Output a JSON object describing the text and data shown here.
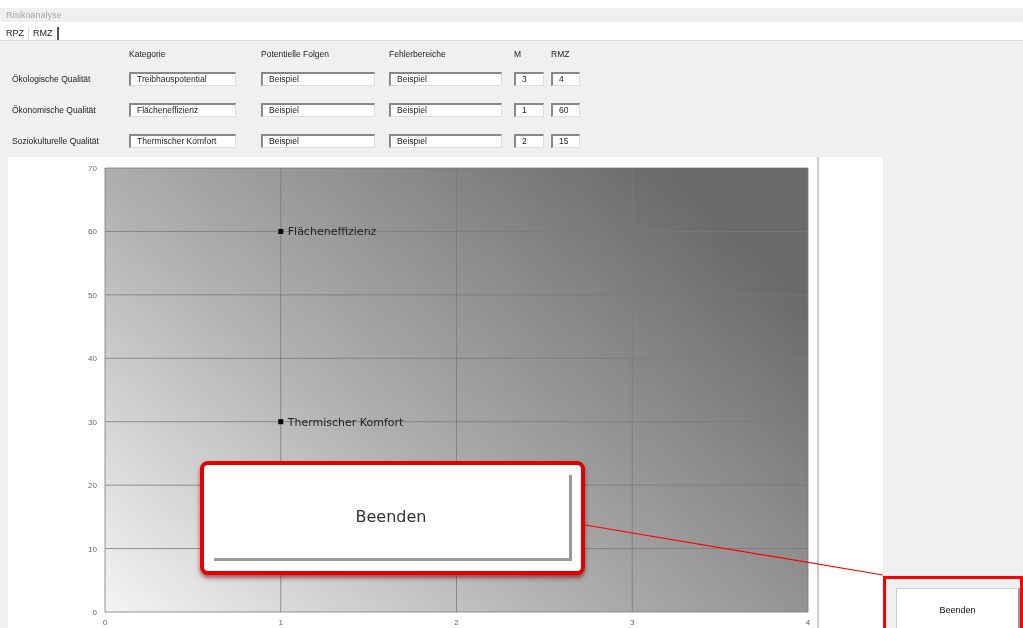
{
  "window": {
    "title": "Risikoanalyse"
  },
  "tabs": [
    {
      "label": "RPZ",
      "selected": false
    },
    {
      "label": "RMZ",
      "selected": true
    }
  ],
  "form": {
    "columns": [
      "Kategorie",
      "Potentielle Folgen",
      "Fehlerbereiche",
      "M",
      "RMZ"
    ],
    "rows": [
      {
        "label": "Ökologische Qualität",
        "values": [
          "Treibhauspotential",
          "Beispiel",
          "Beispiel",
          "3",
          "4"
        ]
      },
      {
        "label": "Ökonomische Qualität",
        "values": [
          "Flächeneffizienz",
          "Beispiel",
          "Beispiel",
          "1",
          "60"
        ]
      },
      {
        "label": "Soziokulturelle Qualität",
        "values": [
          "Thermischer Komfort",
          "Beispiel",
          "Beispiel",
          "2",
          "15"
        ]
      }
    ]
  },
  "chart": {
    "chart_data": {
      "type": "scatter",
      "x": [
        1,
        1
      ],
      "series": [
        {
          "color": "#000000",
          "values": [
            60,
            30
          ]
        }
      ],
      "grid": true,
      "xlim": [
        0,
        4
      ],
      "ylim": [
        0,
        70
      ],
      "xticks": [
        0,
        1,
        2,
        3,
        4
      ],
      "yticks": [
        0,
        10,
        20,
        30,
        40,
        50,
        60,
        70
      ],
      "annotations": [
        {
          "x": 1,
          "y": 60,
          "text": "Flächeneffizienz"
        },
        {
          "x": 1,
          "y": 30,
          "text": "Thermischer Komfort"
        }
      ]
    }
  },
  "callout": {
    "label": "Beenden"
  },
  "button": {
    "label": "Beenden"
  }
}
